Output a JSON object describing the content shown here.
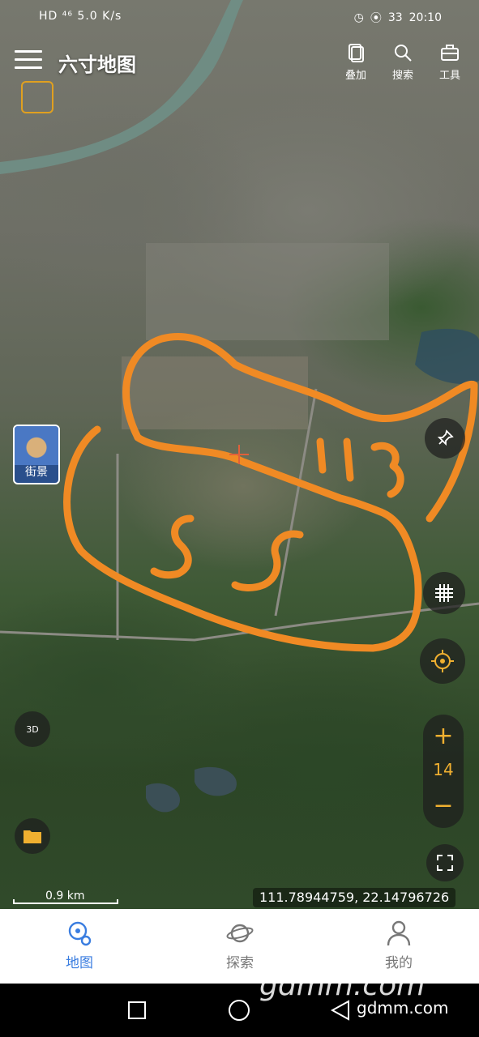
{
  "status_bar": {
    "left": "HD ⁴⁶ 5.0 K/s",
    "battery": "33",
    "time": "20:10"
  },
  "app": {
    "title": "六寸地图"
  },
  "toolbar": {
    "layers_label": "叠加",
    "search_label": "搜索",
    "tools_label": "工具"
  },
  "map": {
    "street_view_label": "街景",
    "zoom_level": "14",
    "zoom_in": "+",
    "zoom_out": "−",
    "scale_label": "0.9 km",
    "coordinates": "111.78944759, 22.14796726",
    "three_d_label": "3D"
  },
  "bottom_nav": {
    "items": [
      {
        "label": "地图"
      },
      {
        "label": "探索"
      },
      {
        "label": "我的"
      }
    ]
  },
  "watermark": {
    "main": "gdmm.com",
    "small": "gdmm.com"
  },
  "colors": {
    "accent": "#3a7de0",
    "annotation": "#f08a24",
    "zoom": "#f0b030"
  }
}
